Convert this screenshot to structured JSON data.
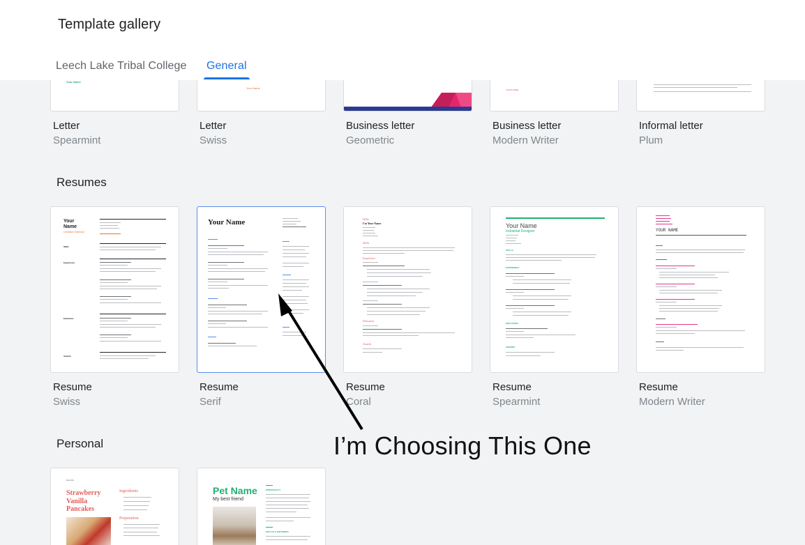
{
  "header": {
    "title": "Template gallery",
    "tabs": [
      {
        "label": "Leech Lake Tribal College",
        "active": false
      },
      {
        "label": "General",
        "active": true
      }
    ]
  },
  "sections": {
    "letters": {
      "cards": [
        {
          "name": "Letter",
          "style": "Spearmint",
          "thumb_text": "Your Name"
        },
        {
          "name": "Letter",
          "style": "Swiss",
          "thumb_text": "Your Name"
        },
        {
          "name": "Business letter",
          "style": "Geometric"
        },
        {
          "name": "Business letter",
          "style": "Modern Writer",
          "thumb_text": "YOUR NAME"
        },
        {
          "name": "Informal letter",
          "style": "Plum"
        }
      ]
    },
    "resumes": {
      "title": "Resumes",
      "cards": [
        {
          "name": "Resume",
          "style": "Swiss",
          "thumb_name": "Your Name",
          "thumb_role": "Creative Director",
          "thumb_sections": [
            "Skills",
            "Experience",
            "Education",
            "Awards"
          ]
        },
        {
          "name": "Resume",
          "style": "Serif",
          "thumb_name": "Your Name",
          "selected": true
        },
        {
          "name": "Resume",
          "style": "Coral",
          "thumb_greeting": "Hello",
          "thumb_name": "I'm Your Name",
          "thumb_sections": [
            "Skills",
            "Experience",
            "Education",
            "Awards"
          ]
        },
        {
          "name": "Resume",
          "style": "Spearmint",
          "thumb_name": "Your Name",
          "thumb_role": "Industrial Designer",
          "thumb_sections": [
            "SKILLS",
            "EXPERIENCE",
            "EDUCATION",
            "AWARDS"
          ]
        },
        {
          "name": "Resume",
          "style": "Modern Writer",
          "thumb_name": "YOUR NAME"
        }
      ]
    },
    "personal": {
      "title": "Personal",
      "cards": [
        {
          "thumb_recipe": "RECIPE",
          "thumb_title": "Strawberry Vanilla Pancakes",
          "thumb_ingredients": "Ingredients",
          "thumb_preparation": "Preparation"
        },
        {
          "thumb_title": "Pet Name",
          "thumb_subtitle": "My best friend",
          "thumb_personality": "PERSONALITY",
          "thumb_health": "HEALTH & GROOMING"
        }
      ]
    }
  },
  "annotation": {
    "text": "I’m Choosing This One",
    "color": "#111111"
  },
  "colors": {
    "accent": "#1a73e8",
    "coral": "#e35d5b",
    "spearmint": "#20b16f",
    "swiss_orange": "#f26f21",
    "geometric_pink": "#e6266a",
    "geometric_navy": "#2c3a8f",
    "plum": "#e3388a"
  }
}
